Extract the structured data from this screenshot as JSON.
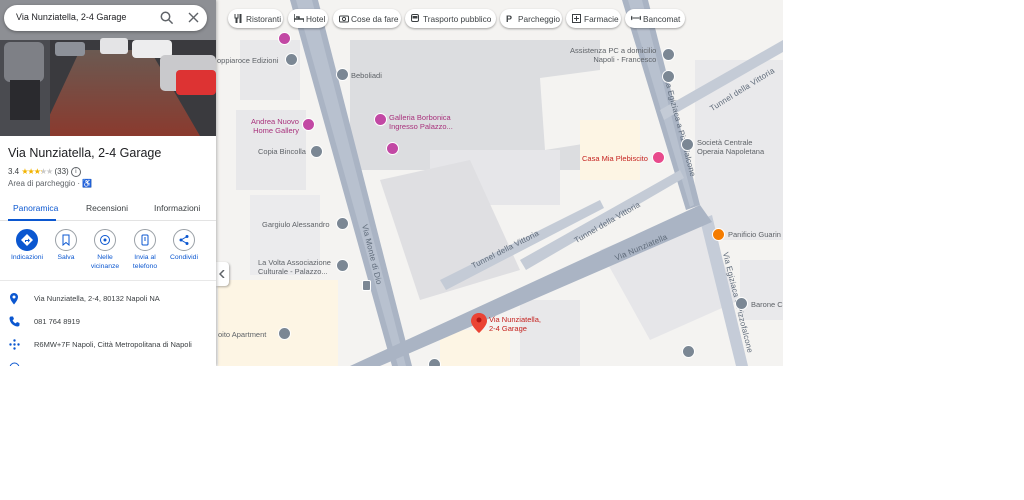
{
  "search": {
    "query": "Via Nunziatella, 2-4 Garage"
  },
  "place": {
    "title": "Via Nunziatella, 2-4 Garage",
    "rating_value": "3.4",
    "rating_stars": 3.4,
    "review_count": "(33)",
    "category": "Area di parcheggio · ♿"
  },
  "tabs": [
    "Panoramica",
    "Recensioni",
    "Informazioni"
  ],
  "actions": [
    {
      "label": "Indicazioni",
      "icon": "directions-icon"
    },
    {
      "label": "Salva",
      "icon": "bookmark-icon"
    },
    {
      "label": "Nelle vicinanze",
      "icon": "nearby-icon"
    },
    {
      "label": "Invia al telefono",
      "icon": "phone-send-icon"
    },
    {
      "label": "Condividi",
      "icon": "share-icon"
    }
  ],
  "info": {
    "address": "Via Nunziatella, 2-4, 80132 Napoli NA",
    "phone": "081 764 8919",
    "plus_code": "R6MW+7F Napoli, Città Metropolitana di Napoli"
  },
  "chips": [
    {
      "label": "Ristoranti",
      "icon": "restaurant-icon"
    },
    {
      "label": "Hotel",
      "icon": "hotel-icon"
    },
    {
      "label": "Cose da fare",
      "icon": "camera-icon"
    },
    {
      "label": "Trasporto pubblico",
      "icon": "transit-icon"
    },
    {
      "label": "Parcheggio",
      "icon": "parking-icon"
    },
    {
      "label": "Farmacie",
      "icon": "pharmacy-icon"
    },
    {
      "label": "Bancomat",
      "icon": "atm-icon"
    }
  ],
  "map": {
    "pois": {
      "edizioni": "oppiaroce Edizioni",
      "beboliadi": "Beboliadi",
      "assistenza": "Assistenza PC a domicilio\nNapoli - Francesco",
      "galleria": "Galleria Borbonica\nIngresso Palazzo...",
      "andrea": "Andrea Nuovo\nHome Gallery",
      "copia": "Copia Bincolla",
      "societa": "Società Centrale\nOperaia Napoletana",
      "casa_mia": "Casa Mia Plebiscito",
      "panificio": "Panificio Guarin",
      "gargiulo": "Gargiulo Alessandro",
      "volta": "La Volta Associazione\nCulturale - Palazzo...",
      "barone": "Barone C",
      "apartment": "oito Apartment",
      "selected": "Via Nunziatella,\n2-4 Garage"
    },
    "streets": {
      "monte_di_dio": "Via Monte di Dio",
      "vittoria_1": "Tunnel della Vittoria",
      "vittoria_2": "Tunnel della Vittoria",
      "vittoria_3": "Tunnel della Vittoria",
      "nunziatella": "Via Nunziatella",
      "egiziaca_1": "Via Egiziaca a Pizzofalcone",
      "egiziaca_2": "Via Egiziaca a Pizzofalcone"
    }
  }
}
